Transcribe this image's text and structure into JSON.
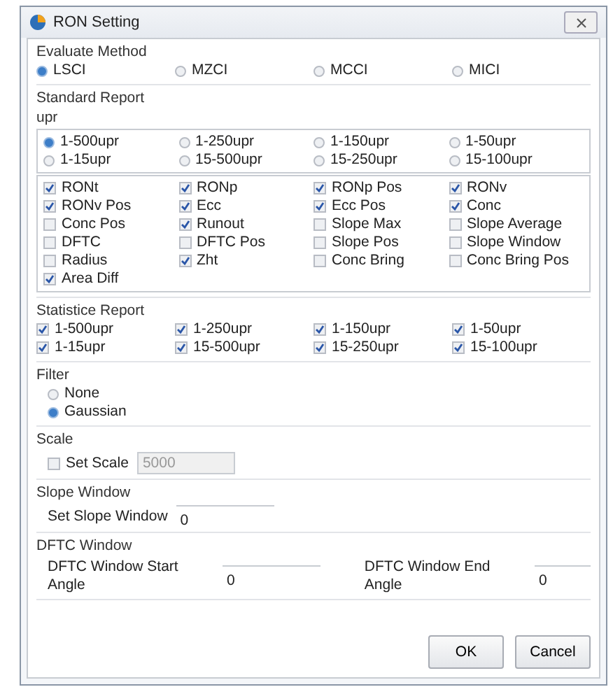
{
  "window": {
    "title": "RON Setting"
  },
  "evaluate_method": {
    "title": "Evaluate Method",
    "options": [
      {
        "label": "LSCI",
        "selected": true
      },
      {
        "label": "MZCI",
        "selected": false
      },
      {
        "label": "MCCI",
        "selected": false
      },
      {
        "label": "MICI",
        "selected": false
      }
    ]
  },
  "standard_report": {
    "title": "Standard Report",
    "upr_label": "upr",
    "upr_options": [
      {
        "label": "1-500upr",
        "selected": true
      },
      {
        "label": "1-250upr",
        "selected": false
      },
      {
        "label": "1-150upr",
        "selected": false
      },
      {
        "label": "1-50upr",
        "selected": false
      },
      {
        "label": "1-15upr",
        "selected": false
      },
      {
        "label": "15-500upr",
        "selected": false
      },
      {
        "label": "15-250upr",
        "selected": false
      },
      {
        "label": "15-100upr",
        "selected": false
      }
    ],
    "items": [
      {
        "label": "RONt",
        "checked": true
      },
      {
        "label": "RONp",
        "checked": true
      },
      {
        "label": "RONp Pos",
        "checked": true
      },
      {
        "label": "RONv",
        "checked": true
      },
      {
        "label": "RONv Pos",
        "checked": true
      },
      {
        "label": "Ecc",
        "checked": true
      },
      {
        "label": "Ecc Pos",
        "checked": true
      },
      {
        "label": "Conc",
        "checked": true
      },
      {
        "label": "Conc Pos",
        "checked": false
      },
      {
        "label": "Runout",
        "checked": true
      },
      {
        "label": "Slope Max",
        "checked": false
      },
      {
        "label": "Slope Average",
        "checked": false
      },
      {
        "label": "DFTC",
        "checked": false
      },
      {
        "label": "DFTC Pos",
        "checked": false
      },
      {
        "label": "Slope Pos",
        "checked": false
      },
      {
        "label": "Slope Window",
        "checked": false
      },
      {
        "label": "Radius",
        "checked": false
      },
      {
        "label": "Zht",
        "checked": true
      },
      {
        "label": "Conc Bring",
        "checked": false
      },
      {
        "label": "Conc Bring Pos",
        "checked": false
      },
      {
        "label": "Area Diff",
        "checked": true
      }
    ]
  },
  "statistice_report": {
    "title": "Statistice Report",
    "items": [
      {
        "label": "1-500upr",
        "checked": true
      },
      {
        "label": "1-250upr",
        "checked": true
      },
      {
        "label": "1-150upr",
        "checked": true
      },
      {
        "label": "1-50upr",
        "checked": true
      },
      {
        "label": "1-15upr",
        "checked": true
      },
      {
        "label": "15-500upr",
        "checked": true
      },
      {
        "label": "15-250upr",
        "checked": true
      },
      {
        "label": "15-100upr",
        "checked": true
      }
    ]
  },
  "filter": {
    "title": "Filter",
    "options": [
      {
        "label": "None",
        "selected": false
      },
      {
        "label": "Gaussian",
        "selected": true
      }
    ]
  },
  "scale": {
    "title": "Scale",
    "checkbox": {
      "label": "Set Scale",
      "checked": false
    },
    "value": "5000"
  },
  "slope_window": {
    "title": "Slope Window",
    "label": "Set Slope Window",
    "value": "0"
  },
  "dftc_window": {
    "title": "DFTC Window",
    "start_label": "DFTC Window Start Angle",
    "start_value": "0",
    "end_label": "DFTC Window End Angle",
    "end_value": "0"
  },
  "buttons": [
    {
      "label": "OK"
    },
    {
      "label": "Cancel"
    }
  ]
}
